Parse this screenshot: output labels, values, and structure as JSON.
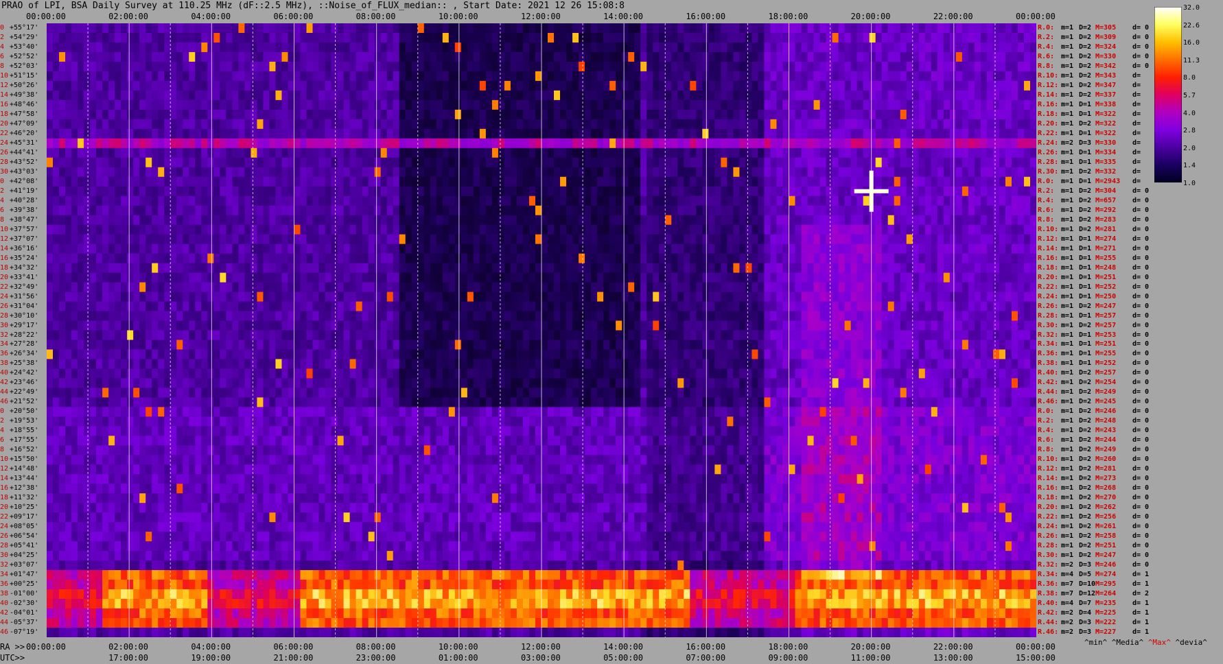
{
  "title": "PRAO of LPI, BSA Daily Survey at 110.25 MHz (dF::2.5 MHz), ::Noise_of_FLUX_median:: , Start Date: 2021 12 26 15:08:8",
  "top_axis": [
    "00:00:00",
    "02:00:00",
    "04:00:00",
    "06:00:00",
    "08:00:00",
    "10:00:00",
    "12:00:00",
    "14:00:00",
    "16:00:00",
    "18:00:00",
    "20:00:00",
    "22:00:00",
    "00:00:00"
  ],
  "bottom_axis_ra_prefix": "RA >>",
  "bottom_axis_ra": [
    "00:00:00",
    "02:00:00",
    "04:00:00",
    "06:00:00",
    "08:00:00",
    "10:00:00",
    "12:00:00",
    "14:00:00",
    "16:00:00",
    "18:00:00",
    "20:00:00",
    "22:00:00",
    "00:00:00"
  ],
  "bottom_axis_utc_prefix": "UTC>>",
  "bottom_axis_utc": [
    "17:00:00",
    "19:00:00",
    "21:00:00",
    "23:00:00",
    "01:00:00",
    "03:00:00",
    "05:00:00",
    "07:00:00",
    "09:00:00",
    "11:00:00",
    "13:00:00",
    "15:00:00"
  ],
  "legend": {
    "min": "^min^",
    "media": "^Media^",
    "max": "^Max^",
    "devia": "^devia^"
  },
  "colorbar": {
    "ticks": [
      "32.0",
      "22.6",
      "16.0",
      "11.3",
      "8.0",
      "5.7",
      "4.0",
      "2.8",
      "2.0",
      "1.4",
      "1.0"
    ],
    "colors": [
      "#000020",
      "#1a0060",
      "#4a00a0",
      "#8000e0",
      "#b000c0",
      "#e00060",
      "#ff2000",
      "#ff7000",
      "#ffc000",
      "#ffff60",
      "#ffffff"
    ]
  },
  "declinations": [
    "+55°17'",
    "+54°29'",
    "+53°40'",
    "+52°52'",
    "+52°03'",
    "+51°15'",
    "+50°26'",
    "+49°38'",
    "+48°46'",
    "+47°58'",
    "+47°09'",
    "+46°20'",
    "+45°31'",
    "+44°41'",
    "+43°52'",
    "+43°03'",
    "+42°08'",
    "+41°19'",
    "+40°28'",
    "+39°38'",
    "+38°47'",
    "+37°57'",
    "+37°07'",
    "+36°16'",
    "+35°24'",
    "+34°32'",
    "+33°41'",
    "+32°49'",
    "+31°56'",
    "+31°04'",
    "+30°10'",
    "+29°17'",
    "+28°22'",
    "+27°28'",
    "+26°34'",
    "+25°38'",
    "+24°42'",
    "+23°46'",
    "+22°49'",
    "+21°52'",
    "+20°50'",
    "+19°53'",
    "+18°55'",
    "+17°55'",
    "+16°52'",
    "+15°50'",
    "+14°48'",
    "+13°44'",
    "+12°38'",
    "+11°32'",
    "+10°25'",
    "+09°17'",
    "+08°05'",
    "+06°54'",
    "+05°41'",
    "+04°25'",
    "+03°07'",
    "+01°47'",
    "+00°25'",
    "-01°00'",
    "-02°30'",
    "-04°01'",
    "-05°37'",
    "-07°19'"
  ],
  "row_index": [
    "0",
    "2",
    "4",
    "6",
    "8",
    "10",
    "12",
    "14",
    "16",
    "18",
    "20",
    "22",
    "24",
    "26",
    "28",
    "30",
    "0",
    "2",
    "4",
    "6",
    "8",
    "10",
    "12",
    "14",
    "16",
    "18",
    "20",
    "22",
    "24",
    "26",
    "28",
    "30",
    "32",
    "34",
    "36",
    "38",
    "40",
    "42",
    "44",
    "46",
    "0",
    "2",
    "4",
    "6",
    "8",
    "10",
    "12",
    "14",
    "16",
    "18",
    "20",
    "22",
    "24",
    "26",
    "28",
    "30",
    "32",
    "34",
    "36",
    "38",
    "40",
    "42",
    "44",
    "46"
  ],
  "right_stats": [
    {
      "r": "R.0:",
      "m": "m=1",
      "D": "D=2",
      "M": "M=305",
      "d": "d= 0"
    },
    {
      "r": "R.2:",
      "m": "m=1",
      "D": "D=2",
      "M": "M=309",
      "d": "d= 0"
    },
    {
      "r": "R.4:",
      "m": "m=1",
      "D": "D=2",
      "M": "M=324",
      "d": "d= 0"
    },
    {
      "r": "R.6:",
      "m": "m=1",
      "D": "D=2",
      "M": "M=330",
      "d": "d= 0"
    },
    {
      "r": "R.8:",
      "m": "m=1",
      "D": "D=2",
      "M": "M=342",
      "d": "d= 0"
    },
    {
      "r": "R.10:",
      "m": "m=1",
      "D": "D=2",
      "M": "M=343",
      "d": "d="
    },
    {
      "r": "R.12:",
      "m": "m=1",
      "D": "D=2",
      "M": "M=347",
      "d": "d="
    },
    {
      "r": "R.14:",
      "m": "m=1",
      "D": "D=2",
      "M": "M=337",
      "d": "d="
    },
    {
      "r": "R.16:",
      "m": "m=1",
      "D": "D=1",
      "M": "M=338",
      "d": "d="
    },
    {
      "r": "R.18:",
      "m": "m=1",
      "D": "D=1",
      "M": "M=322",
      "d": "d="
    },
    {
      "r": "R.20:",
      "m": "m=1",
      "D": "D=2",
      "M": "M=322",
      "d": "d="
    },
    {
      "r": "R.22:",
      "m": "m=1",
      "D": "D=1",
      "M": "M=322",
      "d": "d="
    },
    {
      "r": "R.24:",
      "m": "m=2",
      "D": "D=3",
      "M": "M=330",
      "d": "d="
    },
    {
      "r": "R.26:",
      "m": "m=1",
      "D": "D=1",
      "M": "M=334",
      "d": "d="
    },
    {
      "r": "R.28:",
      "m": "m=1",
      "D": "D=1",
      "M": "M=335",
      "d": "d="
    },
    {
      "r": "R.30:",
      "m": "m=1",
      "D": "D=2",
      "M": "M=332",
      "d": "d="
    },
    {
      "r": "R.0:",
      "m": "m=1",
      "D": "D=1",
      "M": "M=2943",
      "d": "d="
    },
    {
      "r": "R.2:",
      "m": "m=1",
      "D": "D=2",
      "M": "M=304",
      "d": "d= 0"
    },
    {
      "r": "R.4:",
      "m": "m=1",
      "D": "D=2",
      "M": "M=657",
      "d": "d= 0"
    },
    {
      "r": "R.6:",
      "m": "m=1",
      "D": "D=2",
      "M": "M=292",
      "d": "d= 0"
    },
    {
      "r": "R.8:",
      "m": "m=1",
      "D": "D=2",
      "M": "M=283",
      "d": "d= 0"
    },
    {
      "r": "R.10:",
      "m": "m=1",
      "D": "D=2",
      "M": "M=281",
      "d": "d= 0"
    },
    {
      "r": "R.12:",
      "m": "m=1",
      "D": "D=1",
      "M": "M=274",
      "d": "d= 0"
    },
    {
      "r": "R.14:",
      "m": "m=1",
      "D": "D=1",
      "M": "M=271",
      "d": "d= 0"
    },
    {
      "r": "R.16:",
      "m": "m=1",
      "D": "D=1",
      "M": "M=255",
      "d": "d= 0"
    },
    {
      "r": "R.18:",
      "m": "m=1",
      "D": "D=1",
      "M": "M=248",
      "d": "d= 0"
    },
    {
      "r": "R.20:",
      "m": "m=1",
      "D": "D=1",
      "M": "M=251",
      "d": "d= 0"
    },
    {
      "r": "R.22:",
      "m": "m=1",
      "D": "D=1",
      "M": "M=252",
      "d": "d= 0"
    },
    {
      "r": "R.24:",
      "m": "m=1",
      "D": "D=1",
      "M": "M=250",
      "d": "d= 0"
    },
    {
      "r": "R.26:",
      "m": "m=1",
      "D": "D=2",
      "M": "M=247",
      "d": "d= 0"
    },
    {
      "r": "R.28:",
      "m": "m=1",
      "D": "D=1",
      "M": "M=257",
      "d": "d= 0"
    },
    {
      "r": "R.30:",
      "m": "m=1",
      "D": "D=2",
      "M": "M=257",
      "d": "d= 0"
    },
    {
      "r": "R.32:",
      "m": "m=1",
      "D": "D=1",
      "M": "M=253",
      "d": "d= 0"
    },
    {
      "r": "R.34:",
      "m": "m=1",
      "D": "D=1",
      "M": "M=251",
      "d": "d= 0"
    },
    {
      "r": "R.36:",
      "m": "m=1",
      "D": "D=1",
      "M": "M=255",
      "d": "d= 0"
    },
    {
      "r": "R.38:",
      "m": "m=1",
      "D": "D=1",
      "M": "M=252",
      "d": "d= 0"
    },
    {
      "r": "R.40:",
      "m": "m=1",
      "D": "D=2",
      "M": "M=257",
      "d": "d= 0"
    },
    {
      "r": "R.42:",
      "m": "m=1",
      "D": "D=2",
      "M": "M=254",
      "d": "d= 0"
    },
    {
      "r": "R.44:",
      "m": "m=1",
      "D": "D=2",
      "M": "M=249",
      "d": "d= 0"
    },
    {
      "r": "R.46:",
      "m": "m=1",
      "D": "D=2",
      "M": "M=245",
      "d": "d= 0"
    },
    {
      "r": "R.0:",
      "m": "m=1",
      "D": "D=2",
      "M": "M=246",
      "d": "d= 0"
    },
    {
      "r": "R.2:",
      "m": "m=1",
      "D": "D=2",
      "M": "M=248",
      "d": "d= 0"
    },
    {
      "r": "R.4:",
      "m": "m=1",
      "D": "D=2",
      "M": "M=243",
      "d": "d= 0"
    },
    {
      "r": "R.6:",
      "m": "m=1",
      "D": "D=2",
      "M": "M=244",
      "d": "d= 0"
    },
    {
      "r": "R.8:",
      "m": "m=1",
      "D": "D=2",
      "M": "M=249",
      "d": "d= 0"
    },
    {
      "r": "R.10:",
      "m": "m=1",
      "D": "D=2",
      "M": "M=260",
      "d": "d= 0"
    },
    {
      "r": "R.12:",
      "m": "m=1",
      "D": "D=2",
      "M": "M=281",
      "d": "d= 0"
    },
    {
      "r": "R.14:",
      "m": "m=1",
      "D": "D=2",
      "M": "M=273",
      "d": "d= 0"
    },
    {
      "r": "R.16:",
      "m": "m=1",
      "D": "D=2",
      "M": "M=268",
      "d": "d= 0"
    },
    {
      "r": "R.18:",
      "m": "m=1",
      "D": "D=2",
      "M": "M=270",
      "d": "d= 0"
    },
    {
      "r": "R.20:",
      "m": "m=1",
      "D": "D=2",
      "M": "M=262",
      "d": "d= 0"
    },
    {
      "r": "R.22:",
      "m": "m=1",
      "D": "D=2",
      "M": "M=256",
      "d": "d= 0"
    },
    {
      "r": "R.24:",
      "m": "m=1",
      "D": "D=2",
      "M": "M=261",
      "d": "d= 0"
    },
    {
      "r": "R.26:",
      "m": "m=1",
      "D": "D=2",
      "M": "M=258",
      "d": "d= 0"
    },
    {
      "r": "R.28:",
      "m": "m=1",
      "D": "D=2",
      "M": "M=251",
      "d": "d= 0"
    },
    {
      "r": "R.30:",
      "m": "m=1",
      "D": "D=2",
      "M": "M=247",
      "d": "d= 0"
    },
    {
      "r": "R.32:",
      "m": "m=2",
      "D": "D=3",
      "M": "M=246",
      "d": "d= 0"
    },
    {
      "r": "R.34:",
      "m": "m=4",
      "D": "D=5",
      "M": "M=274",
      "d": "d= 1"
    },
    {
      "r": "R.36:",
      "m": "m=7",
      "D": "D=10",
      "M": "M=295",
      "d": "d= 1"
    },
    {
      "r": "R.38:",
      "m": "m=7",
      "D": "D=12",
      "M": "M=264",
      "d": "d= 2"
    },
    {
      "r": "R.40:",
      "m": "m=4",
      "D": "D=7",
      "M": "M=235",
      "d": "d= 1"
    },
    {
      "r": "R.42:",
      "m": "m=2",
      "D": "D=4",
      "M": "M=225",
      "d": "d= 1"
    },
    {
      "r": "R.44:",
      "m": "m=2",
      "D": "D=3",
      "M": "M=222",
      "d": "d= 1"
    },
    {
      "r": "R.46:",
      "m": "m=2",
      "D": "D=3",
      "M": "M=227",
      "d": "d= 1"
    }
  ],
  "chart_data": {
    "type": "heatmap",
    "title": "PRAO of LPI, BSA Daily Survey at 110.25 MHz (dF::2.5 MHz), ::Noise_of_FLUX_median:: , Start Date: 2021 12 26 15:08:8",
    "x_ticks_ra": [
      "00:00:00",
      "02:00:00",
      "04:00:00",
      "06:00:00",
      "08:00:00",
      "10:00:00",
      "12:00:00",
      "14:00:00",
      "16:00:00",
      "18:00:00",
      "20:00:00",
      "22:00:00",
      "00:00:00"
    ],
    "x_ticks_utc": [
      "17:00:00",
      "19:00:00",
      "21:00:00",
      "23:00:00",
      "01:00:00",
      "03:00:00",
      "05:00:00",
      "07:00:00",
      "09:00:00",
      "11:00:00",
      "13:00:00",
      "15:00:00"
    ],
    "colorbar_range": [
      1.0,
      32.0
    ],
    "colorbar_scale": "log",
    "rows": 64,
    "features": {
      "hot_band_rows": [
        57,
        62
      ],
      "bright_row": 12,
      "bright_source_ra": "20:00:00",
      "bright_source_row": 17
    }
  }
}
